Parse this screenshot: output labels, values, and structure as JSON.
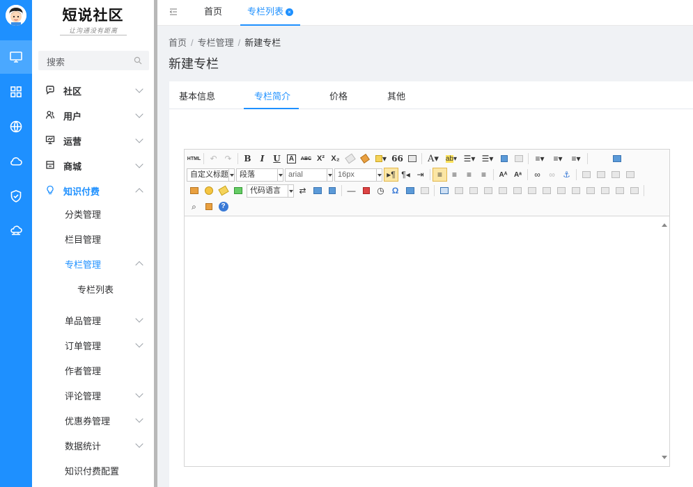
{
  "logo": {
    "title": "短说社区",
    "subtitle": "让沟通没有距离"
  },
  "search": {
    "placeholder": "搜索"
  },
  "rail": {
    "icons": [
      "avatar",
      "monitor-icon",
      "grid-icon",
      "globe-icon",
      "cloud-icon",
      "shield-icon",
      "cloud-network-icon"
    ]
  },
  "sidebar": {
    "menu": [
      {
        "label": "社区",
        "icon": "chat-icon"
      },
      {
        "label": "用户",
        "icon": "users-icon"
      },
      {
        "label": "运营",
        "icon": "presentation-icon"
      },
      {
        "label": "商城",
        "icon": "store-icon"
      },
      {
        "label": "知识付费",
        "icon": "bulb-icon"
      }
    ],
    "sub": [
      {
        "label": "分类管理"
      },
      {
        "label": "栏目管理"
      },
      {
        "label": "专栏管理"
      },
      {
        "label": "专栏列表"
      },
      {
        "label": "单品管理"
      },
      {
        "label": "订单管理"
      },
      {
        "label": "作者管理"
      },
      {
        "label": "评论管理"
      },
      {
        "label": "优惠券管理"
      },
      {
        "label": "数据统计"
      },
      {
        "label": "知识付费配置"
      }
    ]
  },
  "topbar": {
    "tabs": [
      {
        "label": "首页"
      },
      {
        "label": "专栏列表",
        "close": "×"
      }
    ]
  },
  "breadcrumb": [
    {
      "label": "首页"
    },
    {
      "label": "专栏管理"
    },
    {
      "label": "新建专栏"
    }
  ],
  "breadcrumb_sep": "/",
  "page_title": "新建专栏",
  "form_tabs": [
    {
      "label": "基本信息"
    },
    {
      "label": "专栏简介"
    },
    {
      "label": "价格"
    },
    {
      "label": "其他"
    }
  ],
  "editor": {
    "html_label": "HTML",
    "bold": "B",
    "italic": "I",
    "underline": "U",
    "border_a": "A",
    "strike": "ABC",
    "superscript": "X²",
    "subscript": "X₂",
    "quote": "66",
    "font_color": "A",
    "bg_color": "ab",
    "title_select": "自定义标题",
    "paragraph_select": "段落",
    "font_select": "arial",
    "size_select": "16px",
    "code_select": "代码语言",
    "omega": "Ω",
    "hr": "—",
    "help": "?"
  },
  "colors": {
    "accent": "#1e90ff",
    "rail": "#1e90ff",
    "page_bg": "#f0f2f5"
  }
}
